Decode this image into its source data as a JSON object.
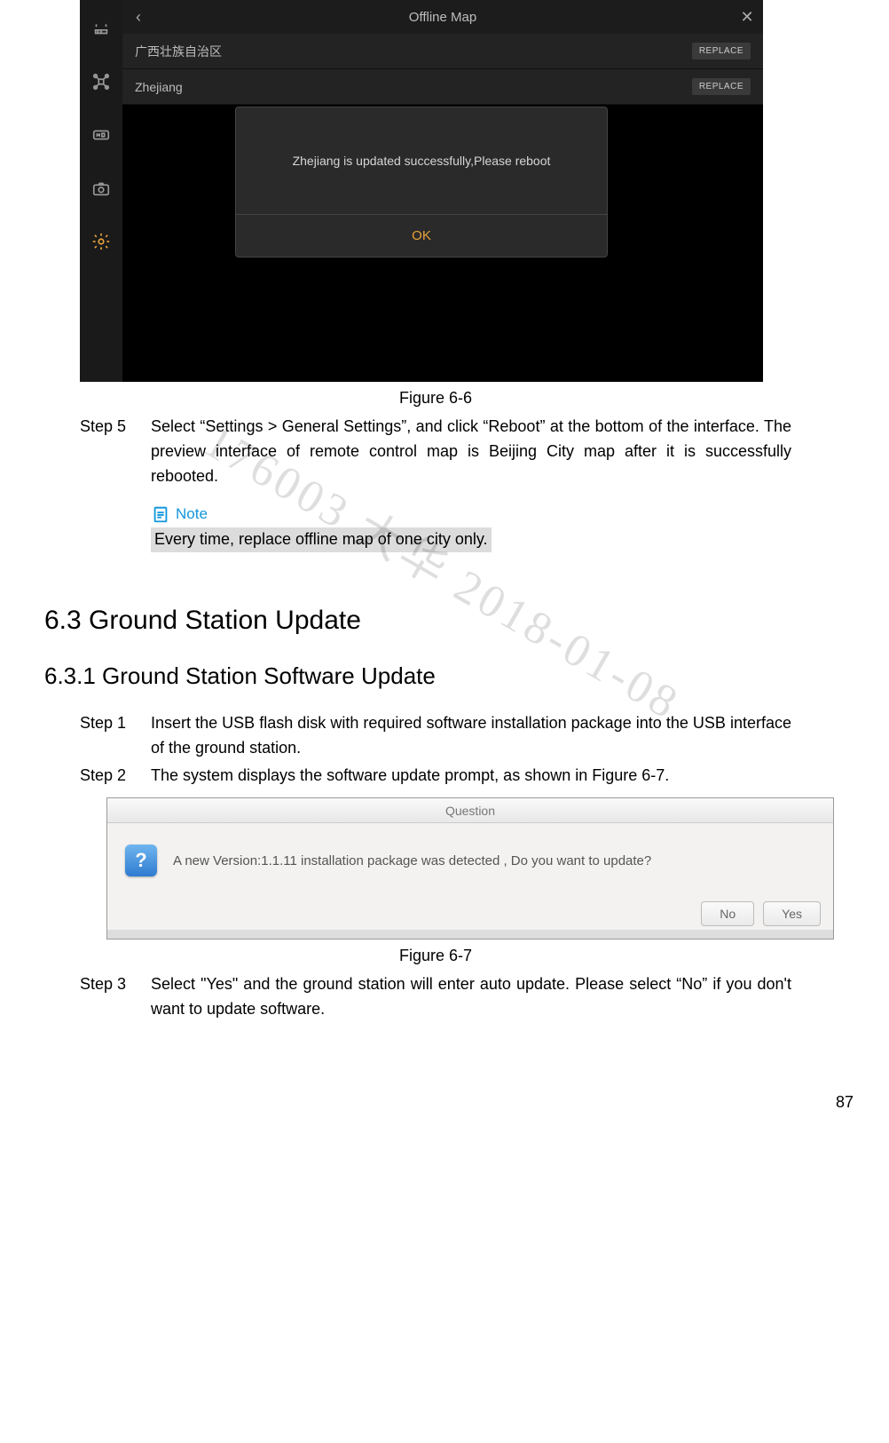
{
  "figure66": {
    "caption": "Figure 6-6",
    "header": {
      "title": "Offline Map",
      "back": "‹",
      "close": "✕"
    },
    "rows": [
      {
        "label": "广西壮族自治区",
        "button": "REPLACE"
      },
      {
        "label": "Zhejiang",
        "button": "REPLACE"
      }
    ],
    "dialog": {
      "message": "Zhejiang is updated successfully,Please reboot",
      "ok": "OK"
    }
  },
  "step5": {
    "label": "Step 5",
    "body": "Select “Settings > General Settings”, and click “Reboot” at the bottom of the interface. The preview interface of remote control map is Beijing City map after it is successfully rebooted."
  },
  "note": {
    "label": "Note",
    "text": "Every time, replace offline map of one city only.  "
  },
  "headings": {
    "h63": "6.3  Ground Station Update",
    "h631": "6.3.1    Ground Station Software Update"
  },
  "step1": {
    "label": "Step 1",
    "body": "Insert the USB flash disk with required software installation package into the USB interface of the ground station."
  },
  "step2": {
    "label": "Step 2",
    "body": "The system displays the software update prompt, as shown in Figure 6-7."
  },
  "figure67": {
    "caption": "Figure 6-7",
    "title": "Question",
    "message": "A new Version:1.1.11 installation package was detected , Do you want to update?",
    "buttons": {
      "no": "No",
      "yes": "Yes"
    }
  },
  "step3": {
    "label": "Step 3",
    "body": "Select \"Yes\" and the ground station will enter auto update. Please select “No” if you don't want to update software."
  },
  "watermark": "176003 大华 2018-01-08",
  "pagenum": "87"
}
